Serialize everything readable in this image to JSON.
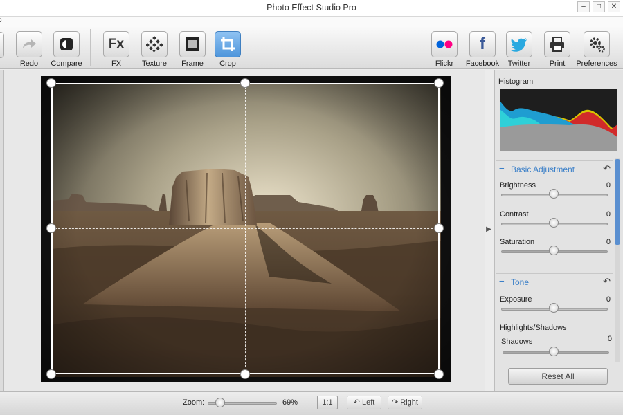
{
  "window": {
    "title": "Photo Effect Studio Pro",
    "minimize_glyph": "–",
    "maximize_glyph": "□",
    "close_glyph": "✕"
  },
  "menubar": {
    "fragment": "o"
  },
  "toolbar": {
    "left": [
      {
        "key": "redo",
        "label": "Redo",
        "icon": "redo-icon"
      },
      {
        "key": "compare",
        "label": "Compare",
        "icon": "compare-icon"
      },
      {
        "key": "fx",
        "label": "FX",
        "icon": "fx-icon",
        "glyph": "Fx"
      },
      {
        "key": "texture",
        "label": "Texture",
        "icon": "texture-icon"
      },
      {
        "key": "frame",
        "label": "Frame",
        "icon": "frame-icon"
      },
      {
        "key": "crop",
        "label": "Crop",
        "icon": "crop-icon",
        "active": true
      }
    ],
    "right": [
      {
        "key": "flickr",
        "label": "Flickr",
        "icon": "flickr-icon"
      },
      {
        "key": "facebook",
        "label": "Facebook",
        "icon": "facebook-icon",
        "glyph": "f"
      },
      {
        "key": "twitter",
        "label": "Twitter",
        "icon": "twitter-icon"
      },
      {
        "key": "print",
        "label": "Print",
        "icon": "print-icon"
      },
      {
        "key": "preferences",
        "label": "Preferences",
        "icon": "gear-icon"
      }
    ]
  },
  "histogram": {
    "label": "Histogram"
  },
  "sections": {
    "basic": {
      "title": "Basic Adjustment",
      "params": [
        {
          "label": "Brightness",
          "value": "0"
        },
        {
          "label": "Contrast",
          "value": "0"
        },
        {
          "label": "Saturation",
          "value": "0"
        }
      ]
    },
    "tone": {
      "title": "Tone",
      "params": [
        {
          "label": "Exposure",
          "value": "0"
        }
      ],
      "subheading": "Highlights/Shadows",
      "sub_params": [
        {
          "label": "Shadows",
          "value": "0"
        }
      ]
    }
  },
  "reset_all": "Reset All",
  "statusbar": {
    "zoom_label": "Zoom:",
    "zoom_value": "69%",
    "one_to_one": "1:1",
    "rotate_left": "Left",
    "rotate_right": "Right"
  },
  "colors": {
    "accent": "#3a7fc8",
    "crop_active": "#4f96db",
    "flickr_pink": "#ff0084",
    "flickr_blue": "#0063dc",
    "facebook": "#3b5998",
    "twitter": "#2aa9e0"
  }
}
